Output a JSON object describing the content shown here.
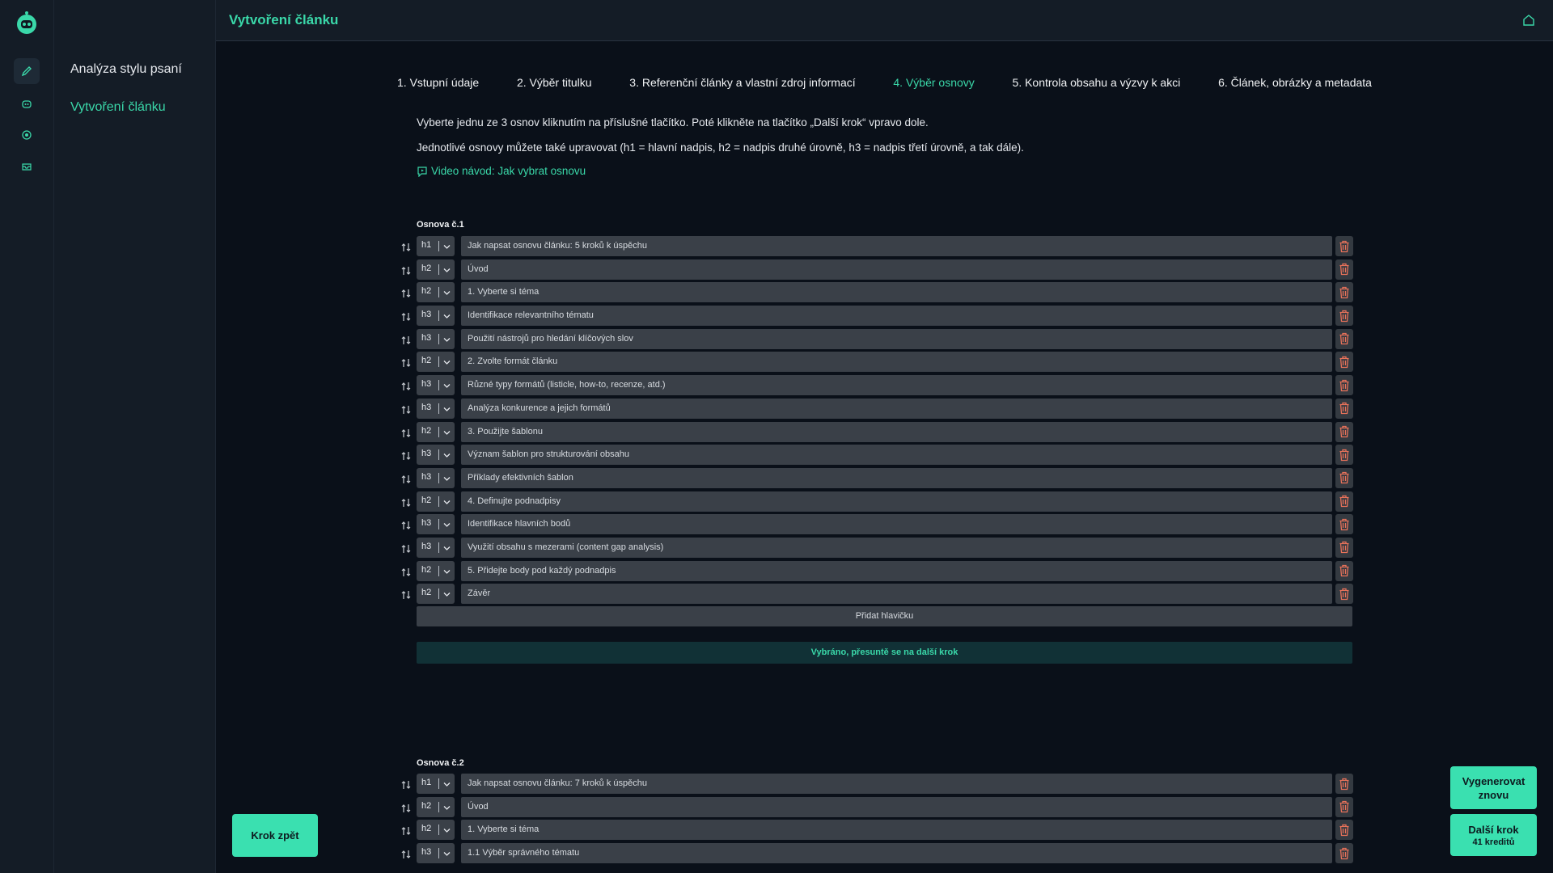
{
  "app": {
    "brand_icon": "robot-logo-icon",
    "accent_color": "#3ad8a9"
  },
  "rail": {
    "items": [
      {
        "icon": "pen-icon",
        "active": true
      },
      {
        "icon": "robot-icon",
        "active": false
      },
      {
        "icon": "target-icon",
        "active": false
      },
      {
        "icon": "inbox-icon",
        "active": false
      }
    ]
  },
  "subnav": {
    "items": [
      {
        "label": "Analýza stylu psaní",
        "active": false
      },
      {
        "label": "Vytvoření článku",
        "active": true
      }
    ]
  },
  "header": {
    "title": "Vytvoření článku",
    "home_icon": "home-icon"
  },
  "steps": [
    {
      "label": "1. Vstupní údaje",
      "active": false
    },
    {
      "label": "2. Výběr titulku",
      "active": false
    },
    {
      "label": "3. Referenční články a vlastní zdroj informací",
      "active": false
    },
    {
      "label": "4. Výběr osnovy",
      "active": true
    },
    {
      "label": "5. Kontrola obsahu a výzvy k akci",
      "active": false
    },
    {
      "label": "6. Článek, obrázky a metadata",
      "active": false
    }
  ],
  "instructions": {
    "line1": "Vyberte jednu ze 3 osnov kliknutím na příslušné tlačítko. Poté klikněte na tlačítko „Další krok“ vpravo dole.",
    "line2": "Jednotlivé osnovy můžete také upravovat (h1 = hlavní nadpis, h2 = nadpis druhé úrovně, h3 = nadpis třetí úrovně, a tak dále).",
    "video_link": "Video návod: Jak vybrat osnovu"
  },
  "outline1": {
    "label": "Osnova č.1",
    "rows": [
      {
        "level": "h1",
        "text": "Jak napsat osnovu článku: 5 kroků k úspěchu"
      },
      {
        "level": "h2",
        "text": "Úvod"
      },
      {
        "level": "h2",
        "text": "1. Vyberte si téma"
      },
      {
        "level": "h3",
        "text": "Identifikace relevantního tématu"
      },
      {
        "level": "h3",
        "text": "Použití nástrojů pro hledání klíčových slov"
      },
      {
        "level": "h2",
        "text": "2. Zvolte formát článku"
      },
      {
        "level": "h3",
        "text": "Různé typy formátů (listicle, how-to, recenze, atd.)"
      },
      {
        "level": "h3",
        "text": "Analýza konkurence a jejich formátů"
      },
      {
        "level": "h2",
        "text": "3. Použijte šablonu"
      },
      {
        "level": "h3",
        "text": "Význam šablon pro strukturování obsahu"
      },
      {
        "level": "h3",
        "text": "Příklady efektivních šablon"
      },
      {
        "level": "h2",
        "text": "4. Definujte podnadpisy"
      },
      {
        "level": "h3",
        "text": "Identifikace hlavních bodů"
      },
      {
        "level": "h3",
        "text": "Využití obsahu s mezerami (content gap analysis)"
      },
      {
        "level": "h2",
        "text": "5. Přidejte body pod každý podnadpis"
      },
      {
        "level": "h2",
        "text": "Závěr"
      }
    ],
    "add_heading_label": "Přidat hlavičku",
    "selected_label": "Vybráno, přesuntě se na další krok"
  },
  "outline2": {
    "label": "Osnova č.2",
    "rows": [
      {
        "level": "h1",
        "text": "Jak napsat osnovu článku: 7 kroků k úspěchu"
      },
      {
        "level": "h2",
        "text": "Úvod"
      },
      {
        "level": "h2",
        "text": "1. Vyberte si téma"
      },
      {
        "level": "h3",
        "text": "1.1 Výběr správného tématu"
      }
    ]
  },
  "buttons": {
    "back": "Krok zpět",
    "regenerate": "Vygenerovat znovu",
    "next": "Další krok",
    "next_credits": "41 kreditů"
  }
}
